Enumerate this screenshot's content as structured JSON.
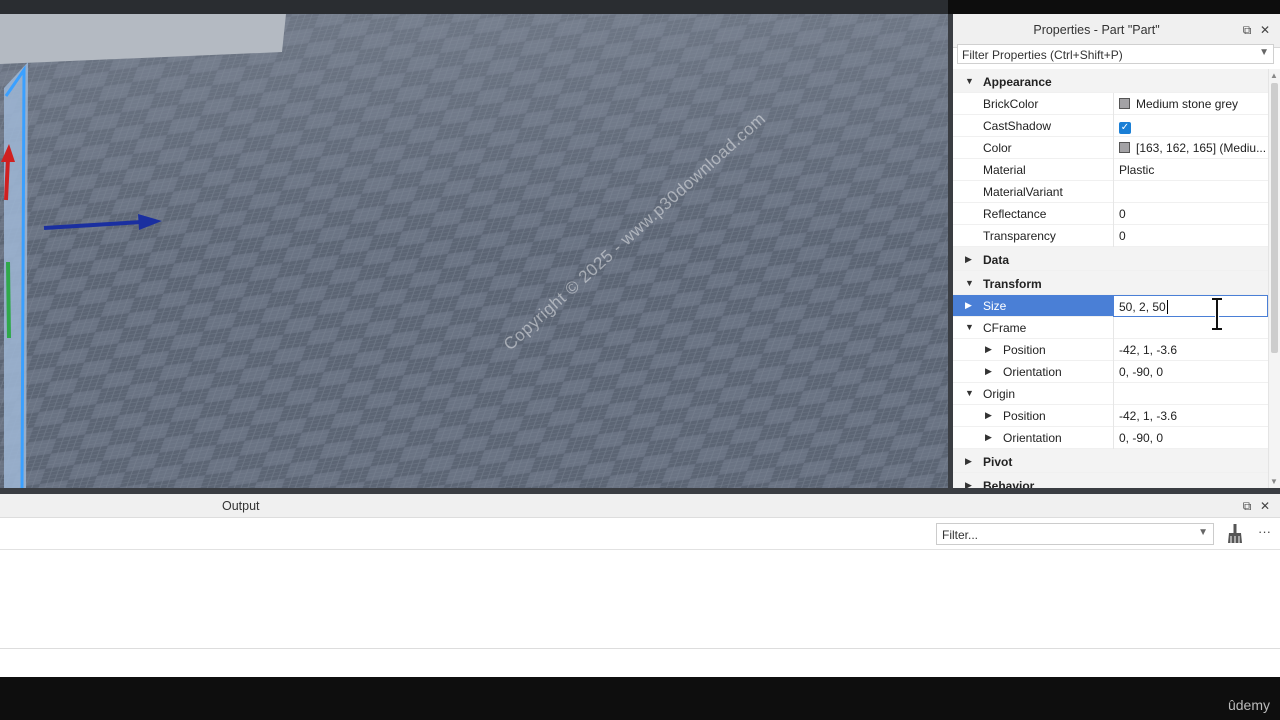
{
  "properties": {
    "title": "Properties - Part \"Part\"",
    "filter_placeholder": "Filter Properties (Ctrl+Shift+P)",
    "rows": [
      {
        "kind": "cat",
        "name": "Appearance",
        "expanded": true
      },
      {
        "kind": "prop",
        "name": "BrickColor",
        "value": "Medium stone grey",
        "swatch": "#a3a2a5"
      },
      {
        "kind": "prop",
        "name": "CastShadow",
        "checked": true
      },
      {
        "kind": "prop",
        "name": "Color",
        "value": "[163, 162, 165] (Mediu...",
        "swatch": "#a3a2a5"
      },
      {
        "kind": "prop",
        "name": "Material",
        "value": "Plastic"
      },
      {
        "kind": "prop",
        "name": "MaterialVariant",
        "value": ""
      },
      {
        "kind": "prop",
        "name": "Reflectance",
        "value": "0"
      },
      {
        "kind": "prop",
        "name": "Transparency",
        "value": "0"
      },
      {
        "kind": "cat",
        "name": "Data",
        "expanded": false
      },
      {
        "kind": "cat",
        "name": "Transform",
        "expanded": true
      },
      {
        "kind": "prop",
        "name": "Size",
        "value": "50, 2, 50",
        "selected": true,
        "editing": true
      },
      {
        "kind": "group",
        "name": "CFrame",
        "value": ""
      },
      {
        "kind": "sub",
        "name": "Position",
        "value": "-42, 1, -3.6"
      },
      {
        "kind": "sub",
        "name": "Orientation",
        "value": "0, -90, 0"
      },
      {
        "kind": "group",
        "name": "Origin",
        "value": ""
      },
      {
        "kind": "sub",
        "name": "Position",
        "value": "-42, 1, -3.6"
      },
      {
        "kind": "sub",
        "name": "Orientation",
        "value": "0, -90, 0"
      },
      {
        "kind": "cat",
        "name": "Pivot",
        "expanded": false
      },
      {
        "kind": "cat",
        "name": "Behavior",
        "expanded": false
      }
    ]
  },
  "output": {
    "title": "Output",
    "filter_placeholder": "Filter..."
  },
  "viewport": {
    "watermark": "Copyright © 2025 - www.p30download.com"
  },
  "footer": {
    "brand": "ûdemy"
  },
  "colors": {
    "selection": "#4a7fd6",
    "checkbox": "#1a7fd6"
  }
}
